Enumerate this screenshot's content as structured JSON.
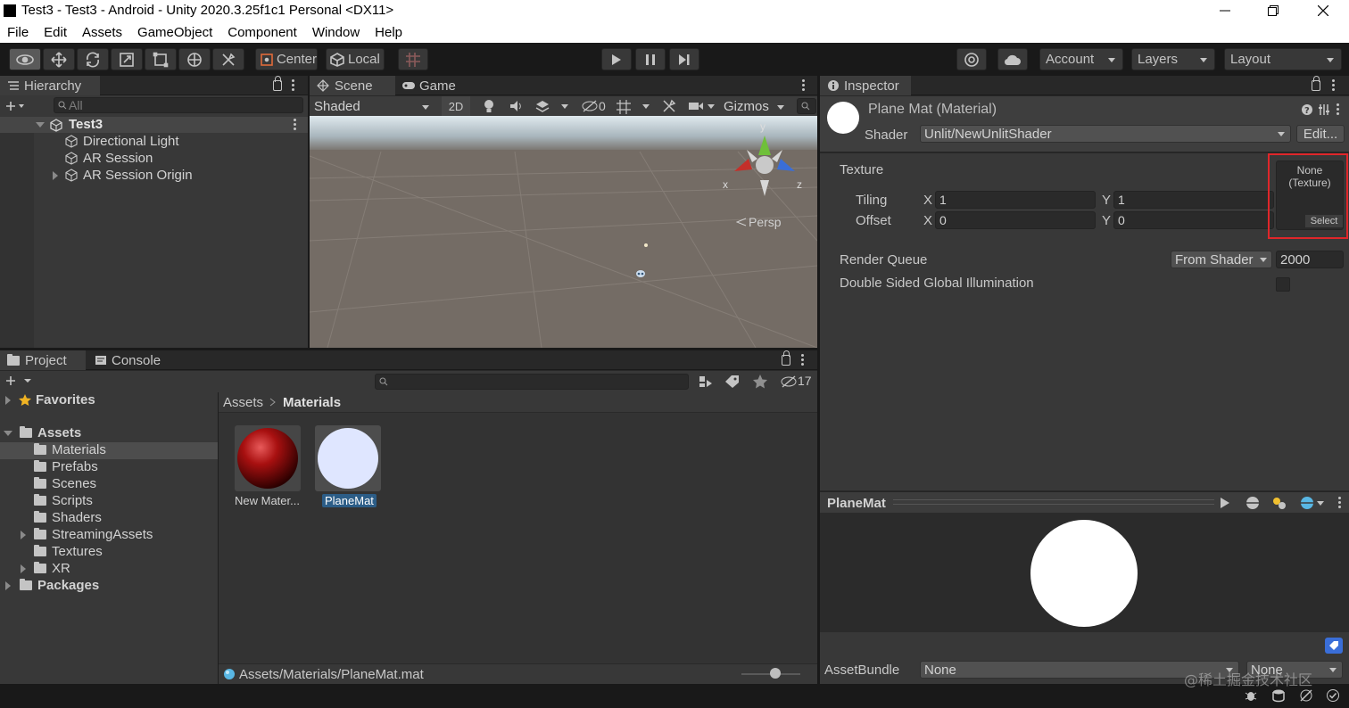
{
  "window": {
    "title": "Test3 - Test3 - Android - Unity 2020.3.25f1c1 Personal <DX11>"
  },
  "menu": [
    "File",
    "Edit",
    "Assets",
    "GameObject",
    "Component",
    "Window",
    "Help"
  ],
  "toolbar": {
    "pivot_label": "Center",
    "space_label": "Local",
    "account_label": "Account",
    "layers_label": "Layers",
    "layout_label": "Layout"
  },
  "hierarchy": {
    "tab": "Hierarchy",
    "search_placeholder": "All",
    "scene_name": "Test3",
    "items": [
      "Directional Light",
      "AR Session",
      "AR Session Origin"
    ]
  },
  "scene": {
    "tabs": [
      "Scene",
      "Game"
    ],
    "shading_mode": "Shaded",
    "mode_2d": "2D",
    "hidden_count": "0",
    "gizmos_label": "Gizmos",
    "projection": "Persp",
    "axis_labels": {
      "x": "x",
      "y": "y",
      "z": "z"
    }
  },
  "project": {
    "tabs": [
      "Project",
      "Console"
    ],
    "hidden_count": "17",
    "favorites": "Favorites",
    "assets_root": "Assets",
    "folders": [
      "Materials",
      "Prefabs",
      "Scenes",
      "Scripts",
      "Shaders",
      "StreamingAssets",
      "Textures",
      "XR"
    ],
    "packages": "Packages",
    "breadcrumb": [
      "Assets",
      "Materials"
    ],
    "files": [
      {
        "name": "New Mater...",
        "kind": "red-sphere"
      },
      {
        "name": "PlaneMat",
        "kind": "white-sphere",
        "selected": true
      }
    ],
    "status_path": "Assets/Materials/PlaneMat.mat"
  },
  "inspector": {
    "tab": "Inspector",
    "material_title": "Plane Mat (Material)",
    "shader_label": "Shader",
    "shader_value": "Unlit/NewUnlitShader",
    "edit_button": "Edit...",
    "texture_label": "Texture",
    "texture_slot": {
      "line1": "None",
      "line2": "(Texture)",
      "select": "Select"
    },
    "tiling_label": "Tiling",
    "offset_label": "Offset",
    "x_label": "X",
    "y_label": "Y",
    "tiling": {
      "x": "1",
      "y": "1"
    },
    "offset": {
      "x": "0",
      "y": "0"
    },
    "render_queue_label": "Render Queue",
    "render_queue_mode": "From Shader",
    "render_queue_value": "2000",
    "dsgi_label": "Double Sided Global Illumination",
    "preview_title": "PlaneMat",
    "asset_bundle_label": "AssetBundle",
    "asset_bundle_value": "None",
    "asset_bundle_variant": "None"
  },
  "watermark": "@稀土掘金技术社区",
  "colors": {
    "highlight_box": "#e0262a",
    "selection": "#2c5d87",
    "panel_bg": "#383838",
    "dark_bg": "#282828"
  }
}
